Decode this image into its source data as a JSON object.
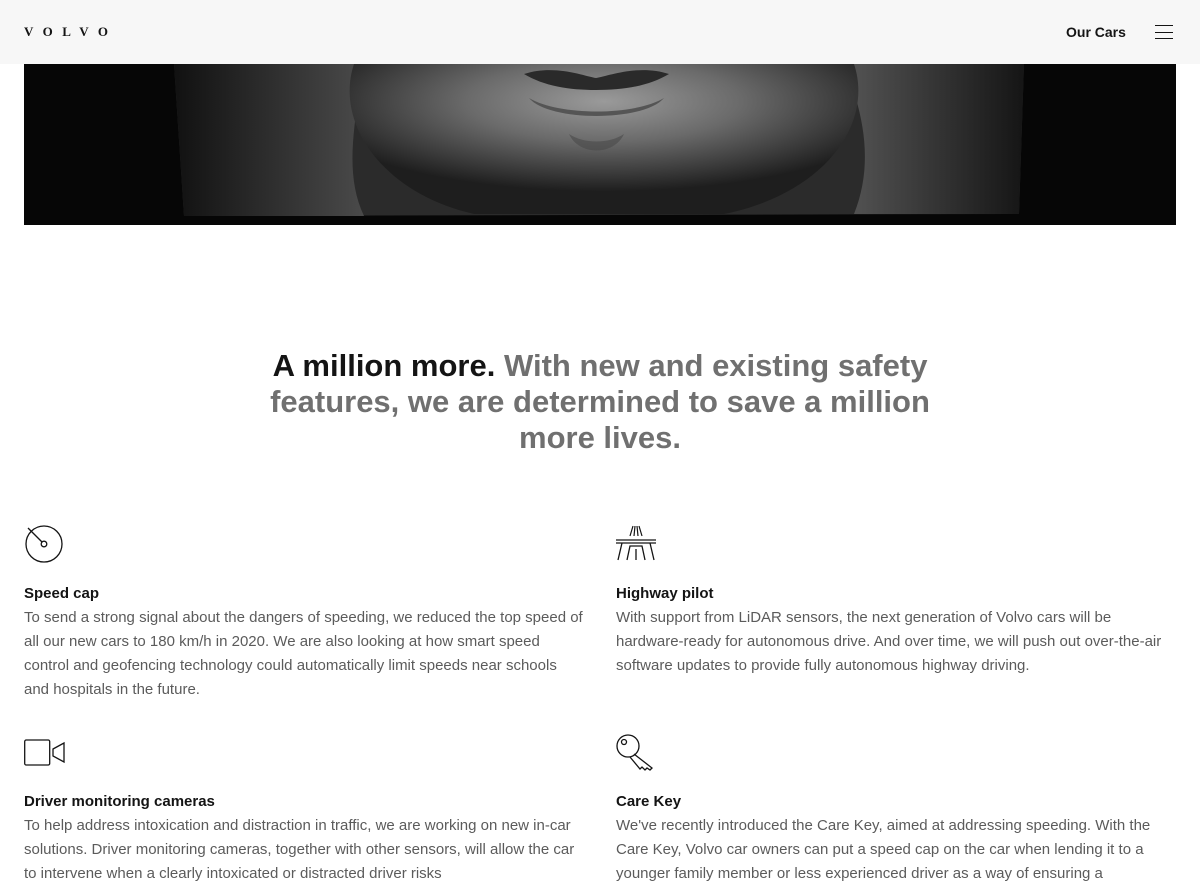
{
  "header": {
    "logo": "VOLVO",
    "nav_link": "Our Cars"
  },
  "hero": {
    "icon": "portrait-image"
  },
  "statement": {
    "lead": "A million more.",
    "rest": "With new and existing safety features, we are determined to save a million more lives."
  },
  "features": [
    {
      "icon": "speedometer-icon",
      "title": "Speed cap",
      "text": "To send a strong signal about the dangers of speeding, we reduced the top speed of all our new cars to 180 km/h in 2020. We are also looking at how smart speed control and geofencing technology could automatically limit speeds near schools and hospitals in the future."
    },
    {
      "icon": "highway-icon",
      "title": "Highway pilot",
      "text": "With support from LiDAR sensors, the next generation of Volvo cars will be hardware-ready for autonomous drive. And over time, we will push out over-the-air software updates to provide fully autonomous highway driving."
    },
    {
      "icon": "camera-icon",
      "title": "Driver monitoring cameras",
      "text": "To help address intoxication and distraction in traffic, we are working on new in-car solutions. Driver monitoring cameras, together with other sensors, will allow the car to intervene when a clearly intoxicated or distracted driver risks"
    },
    {
      "icon": "key-icon",
      "title": "Care Key",
      "text": "We've recently introduced the Care Key, aimed at addressing speeding. With the Care Key, Volvo car owners can put a speed cap on the car when lending it to a younger family member or less experienced driver as a way of ensuring a"
    }
  ]
}
